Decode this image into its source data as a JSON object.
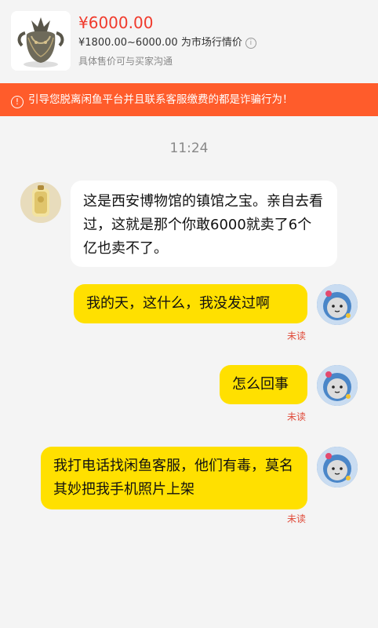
{
  "product": {
    "price": "¥6000.00",
    "range": "¥1800.00~6000.00 为市场行情价",
    "note": "具体售价可与买家沟通"
  },
  "warning": {
    "text": "引导您脱离闲鱼平台并且联系客服缴费的都是诈骗行为！"
  },
  "chat": {
    "time": "11:24",
    "messages": [
      {
        "side": "left",
        "text": "这是西安博物馆的镇馆之宝。亲自去看过，这就是那个你敢6000就卖了6个亿也卖不了。"
      },
      {
        "side": "right",
        "text": "我的天，这什么，我没发过啊",
        "status": "未读"
      },
      {
        "side": "right",
        "text": "怎么回事",
        "status": "未读"
      },
      {
        "side": "right",
        "text": "我打电话找闲鱼客服，他们有毒，莫名其妙把我手机照片上架",
        "status": "未读"
      }
    ]
  }
}
